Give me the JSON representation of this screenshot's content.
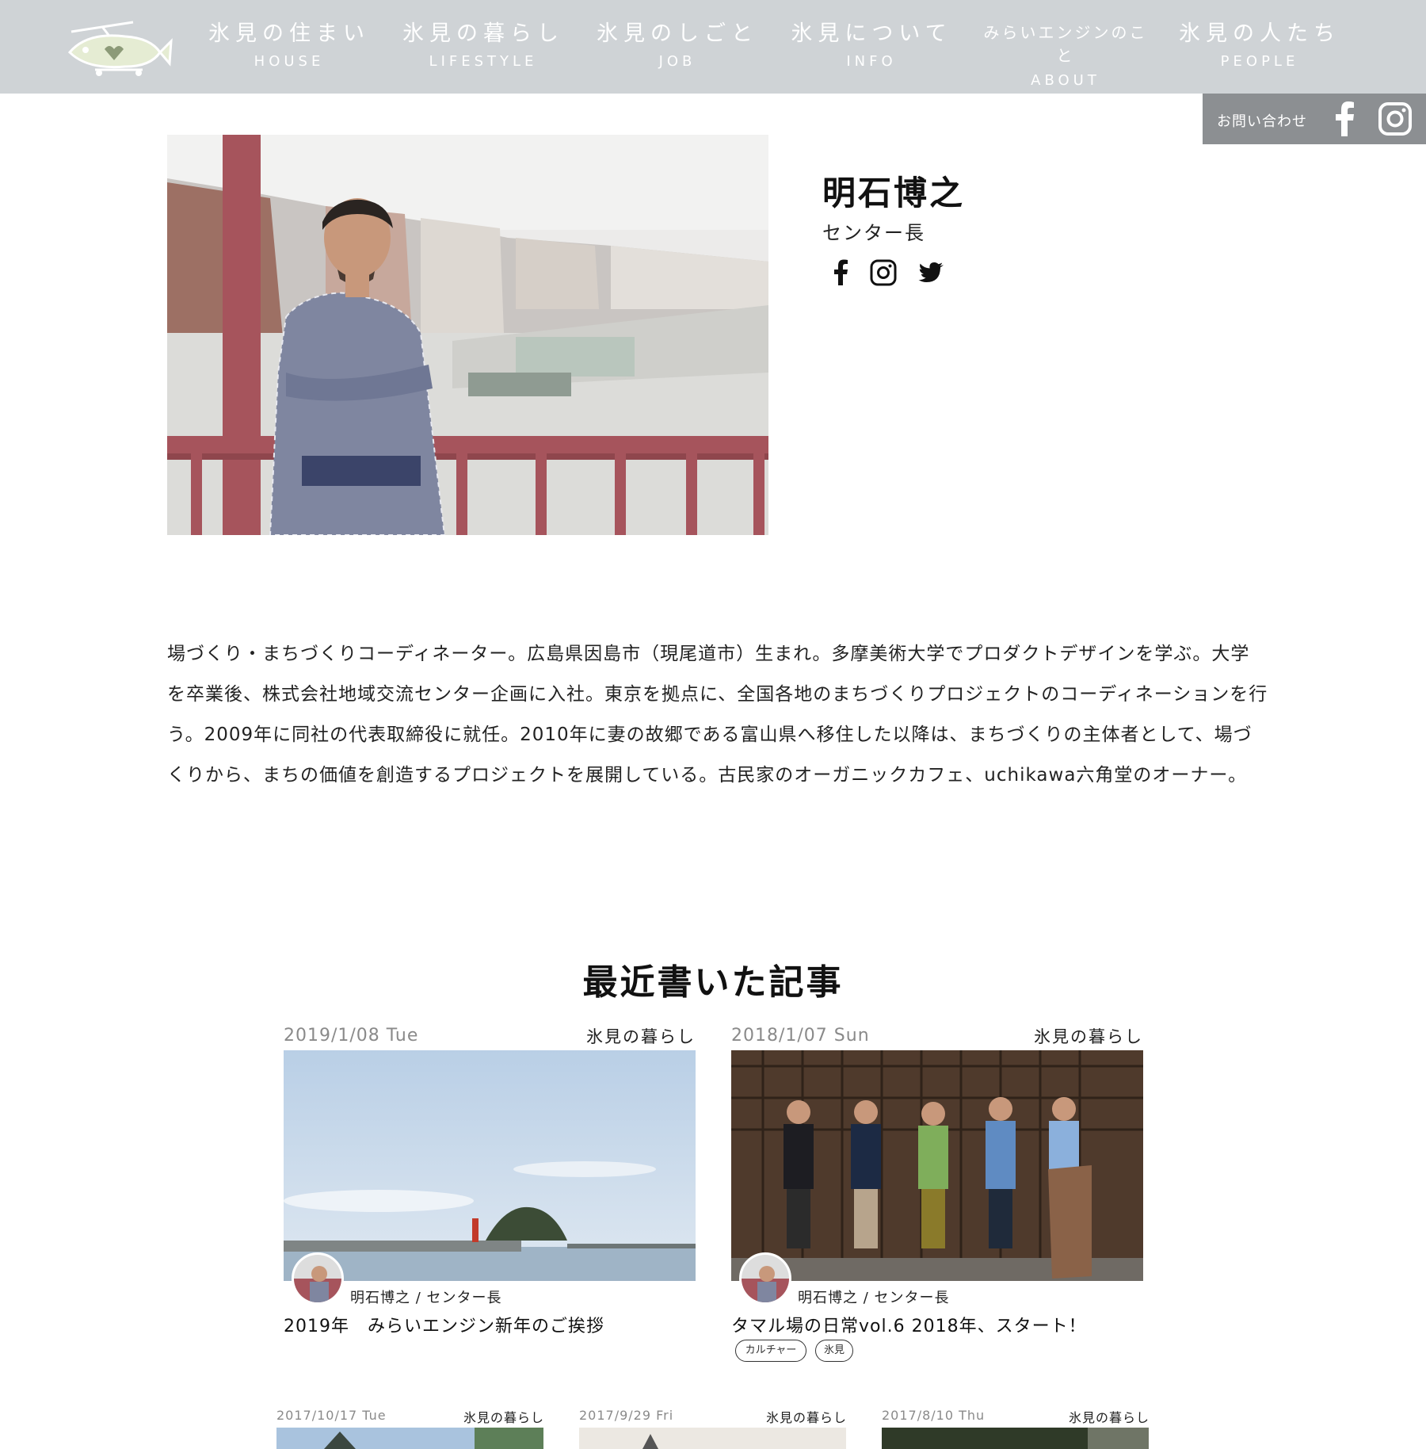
{
  "header": {
    "logo_alt": "氷見みらいエンジン",
    "nav": [
      {
        "jp": "氷見の住まい",
        "en": "HOUSE"
      },
      {
        "jp": "氷見の暮らし",
        "en": "LIFESTYLE"
      },
      {
        "jp": "氷見のしごと",
        "en": "JOB"
      },
      {
        "jp": "氷見について",
        "en": "INFO"
      },
      {
        "jp": "みらいエンジンのこと",
        "en": "ABOUT"
      },
      {
        "jp": "氷見の人たち",
        "en": "PEOPLE"
      }
    ],
    "contact_label": "お問い合わせ"
  },
  "profile": {
    "name": "明石博之",
    "role": "センター長",
    "bio": "場づくり・まちづくりコーディネーター。広島県因島市（現尾道市）生まれ。多摩美術大学でプロダクトデザインを学ぶ。大学を卒業後、株式会社地域交流センター企画に入社。東京を拠点に、全国各地のまちづくりプロジェクトのコーディネーションを行う。2009年に同社の代表取締役に就任。2010年に妻の故郷である富山県へ移住した以降は、まちづくりの主体者として、場づくりから、まちの価値を創造するプロジェクトを展開している。古民家のオーガニックカフェ、uchikawa六角堂のオーナー。"
  },
  "recent": {
    "title": "最近書いた記事",
    "articles": [
      {
        "date": "2019/1/08 Tue",
        "category": "氷見の暮らし",
        "author": "明石博之 / センター長",
        "title": "2019年　みらいエンジン新年のご挨拶",
        "tags": []
      },
      {
        "date": "2018/1/07 Sun",
        "category": "氷見の暮らし",
        "author": "明石博之 / センター長",
        "title": "タマル場の日常vol.6 2018年、スタート！",
        "tags": [
          "カルチャー",
          "氷見"
        ]
      }
    ],
    "more": [
      {
        "date": "2017/10/17 Tue",
        "category": "氷見の暮らし"
      },
      {
        "date": "2017/9/29 Fri",
        "category": "氷見の暮らし"
      },
      {
        "date": "2017/8/10 Thu",
        "category": "氷見の暮らし"
      }
    ]
  },
  "colors": {
    "header_bg": "#cfd3d6",
    "utility_bg": "#8c8f92",
    "text": "#222222",
    "date_gray": "#8a8a8a"
  }
}
